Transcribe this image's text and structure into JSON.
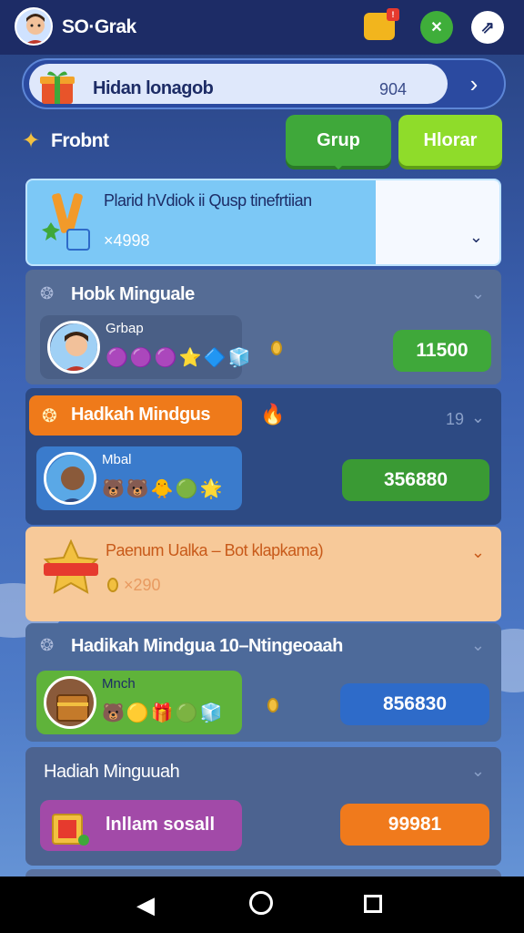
{
  "topbar": {
    "username": "SO·Grak"
  },
  "banner": {
    "title": "Hidan lonagob",
    "count": "904"
  },
  "filter": {
    "label": "Frobnt"
  },
  "tabs": {
    "grup": "Grup",
    "hlorar": "Hlorar"
  },
  "cards": [
    {
      "title": "Plarid hVdiok ii Qusp tinefrtiian",
      "sub": "×4998"
    },
    {
      "title": "Hobk Minguale",
      "reward_label": "Grbap",
      "value": "11500",
      "icons": "🟣🟣🟣⭐🔷🧊"
    },
    {
      "title": "Hadkah Mindgus",
      "reward_label": "Mbal",
      "value": "356880",
      "right_count": "19",
      "icons": "🐻🐻🐥🟢🌟"
    },
    {
      "title": "Paenum Ualka – Bot  klapkama)",
      "sub": "×290"
    },
    {
      "title": "Hadikah Mindgua 10–Ntingeoaah",
      "reward_label": "Mnch",
      "value": "856830",
      "icons": "🐻🟡🎁🟢🧊"
    },
    {
      "title": "Hadiah Minguuah",
      "button_label": "lnllam sosall",
      "value": "99981"
    }
  ],
  "colors": {
    "primary": "#3fa83a",
    "accent": "#ef7a1a",
    "blue": "#2e6bc9"
  }
}
